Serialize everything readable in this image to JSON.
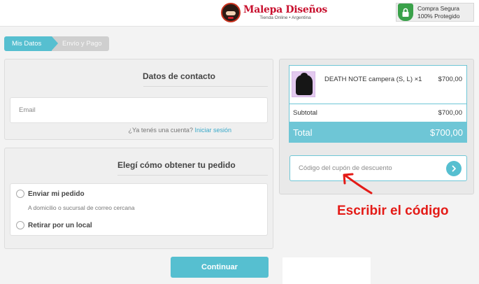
{
  "header": {
    "logo_name": "Malepa Diseños",
    "logo_tagline": "Tienda Online • Argentina",
    "secure_line1": "Compra Segura",
    "secure_line2": "100% Protegido"
  },
  "steps": [
    {
      "label": "Mis Datos",
      "active": true
    },
    {
      "label": "Envío y Pago",
      "active": false
    }
  ],
  "contact": {
    "title": "Datos de contacto",
    "email_placeholder": "Email",
    "has_account_text": "¿Ya tenés una cuenta?",
    "login_link": "Iniciar sesión"
  },
  "shipping": {
    "title": "Elegí cómo obtener tu pedido",
    "options": [
      {
        "label": "Enviar mi pedido",
        "description": "A domicilio o sucursal de correo cercana"
      },
      {
        "label": "Retirar por un local"
      }
    ]
  },
  "continue_label": "Continuar",
  "summary": {
    "product_name": "DEATH NOTE campera (S, L) ×1",
    "product_price": "$700,00",
    "subtotal_label": "Subtotal",
    "subtotal_value": "$700,00",
    "total_label": "Total",
    "total_value": "$700,00",
    "coupon_placeholder": "Código del cupón de descuento"
  },
  "annotation": {
    "text": "Escribir el código",
    "color": "#e41b17"
  },
  "colors": {
    "accent": "#56bfd0",
    "accent_light": "#6ec6d6",
    "secure_green": "#3aa14a",
    "link": "#3aa9c9"
  },
  "icons": {
    "secure": "lock-shield-icon",
    "coupon_submit": "chevron-right-icon",
    "annotation": "arrow-up-left-icon"
  }
}
